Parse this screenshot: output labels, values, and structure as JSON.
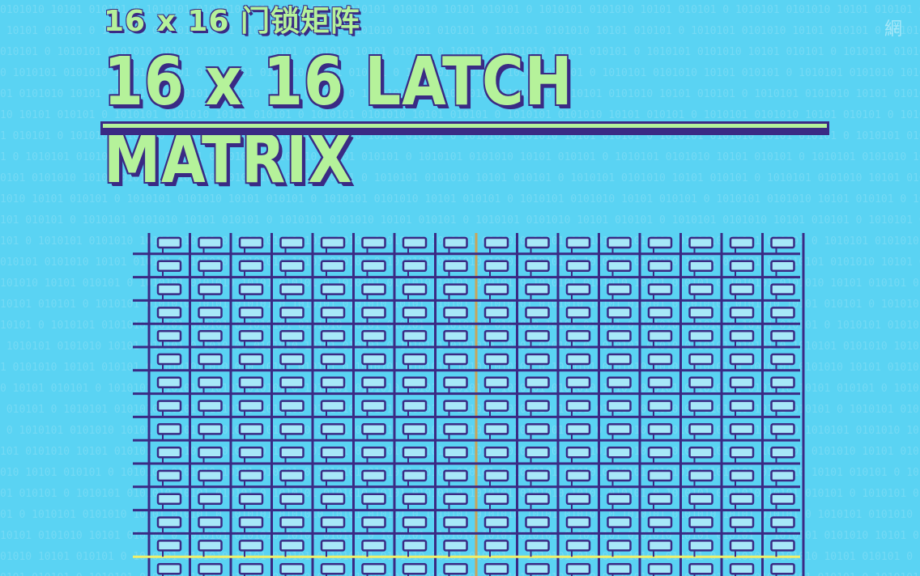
{
  "header": {
    "subtitle": "16 x 16 门锁矩阵",
    "title": "16 x 16 LATCH MATRIX"
  },
  "diagram": {
    "rows": 16,
    "columns": 16,
    "selected_column": 8,
    "selected_row": 13,
    "colors": {
      "background": "#5ad3f3",
      "wire": "#3a2a84",
      "latch_cell_fill": "#a7e8f8",
      "selected_column_wire": "#c9a55a",
      "selected_row_wire": "#f2f069",
      "title_fill": "#b5f29a"
    }
  },
  "background": {
    "pattern": "binary-digits",
    "sample_text": "0101010 10101 010101 0 1010101"
  },
  "watermark": {
    "icon": "channel-logo-icon",
    "glyph": "網"
  }
}
